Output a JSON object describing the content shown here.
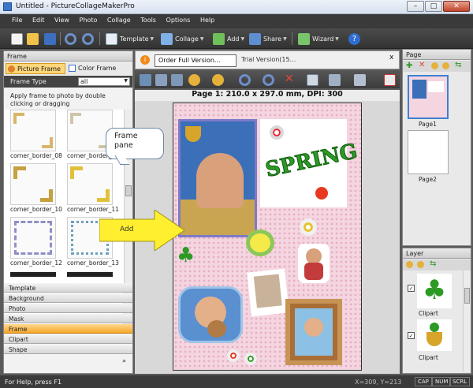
{
  "window": {
    "title": "Untitled - PictureCollageMakerPro"
  },
  "menu": [
    "File",
    "Edit",
    "View",
    "Photo",
    "Collage",
    "Tools",
    "Options",
    "Help"
  ],
  "toolbar": {
    "template_label": "Template",
    "collage_label": "Collage",
    "add_label": "Add",
    "share_label": "Share",
    "wizard_label": "Wizard"
  },
  "left_panel": {
    "title": "Frame",
    "tabs": [
      {
        "label": "Picture Frame",
        "selected": true
      },
      {
        "label": "Color Frame",
        "selected": false
      }
    ],
    "frame_type_label": "Frame Type",
    "frame_type_value": "all",
    "hint": "Apply frame to photo by double clicking or dragging",
    "thumbnails": [
      "corner_border_08",
      "corner_border_09",
      "corner_border_10",
      "corner_border_11",
      "corner_border_12",
      "corner_border_13"
    ],
    "categories": [
      {
        "label": "Template",
        "selected": false
      },
      {
        "label": "Background",
        "selected": false
      },
      {
        "label": "Photo",
        "selected": false
      },
      {
        "label": "Mask",
        "selected": false
      },
      {
        "label": "Frame",
        "selected": true
      },
      {
        "label": "Clipart",
        "selected": false
      },
      {
        "label": "Shape",
        "selected": false
      }
    ],
    "more_glyph": "»"
  },
  "center": {
    "order_button": "Order Full Version...",
    "trial_text": "Trial Version(15...",
    "close_glyph": "x",
    "page_info": "Page 1: 210.0 x 297.0 mm, DPI: 300",
    "callout_text": "Frame pane",
    "arrow_text": "Add"
  },
  "collage": {
    "spring_text": "SPRING"
  },
  "page_panel": {
    "title": "Page",
    "pages": [
      "Page1",
      "Page2"
    ]
  },
  "layer_panel": {
    "title": "Layer",
    "items": [
      "Clipart",
      "Clipart"
    ]
  },
  "status": {
    "help": "For Help, press F1",
    "coords": "X=309, Y=213",
    "indicators": [
      "CAP",
      "NUM",
      "SCRL"
    ]
  },
  "colors": {
    "accent": "#ffd67a",
    "menubar": "#3a3a3a"
  }
}
